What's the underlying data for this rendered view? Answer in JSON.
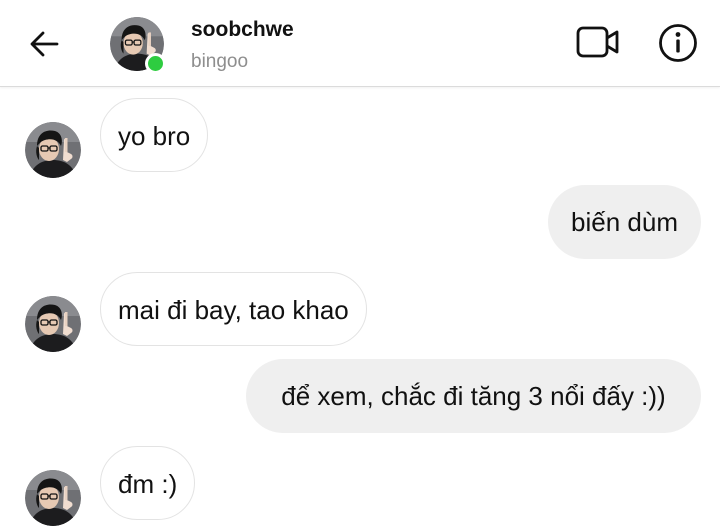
{
  "header": {
    "contact_name": "soobchwe",
    "contact_subtitle": "bingoo",
    "back_icon": "arrow-left-icon",
    "video_icon": "video-camera-icon",
    "info_icon": "info-icon",
    "online_status_color": "#2ecc40"
  },
  "messages": [
    {
      "direction": "incoming",
      "text": "yo bro"
    },
    {
      "direction": "outgoing",
      "text": "biến dùm"
    },
    {
      "direction": "incoming",
      "text": "mai đi bay, tao khao"
    },
    {
      "direction": "outgoing",
      "text": "để xem, chắc đi tăng 3 nổi đấy :))"
    },
    {
      "direction": "incoming",
      "text": "đm :)"
    }
  ],
  "colors": {
    "incoming_bubble_bg": "#ffffff",
    "outgoing_bubble_bg": "#efefef",
    "subtitle": "#8e8e8e"
  }
}
